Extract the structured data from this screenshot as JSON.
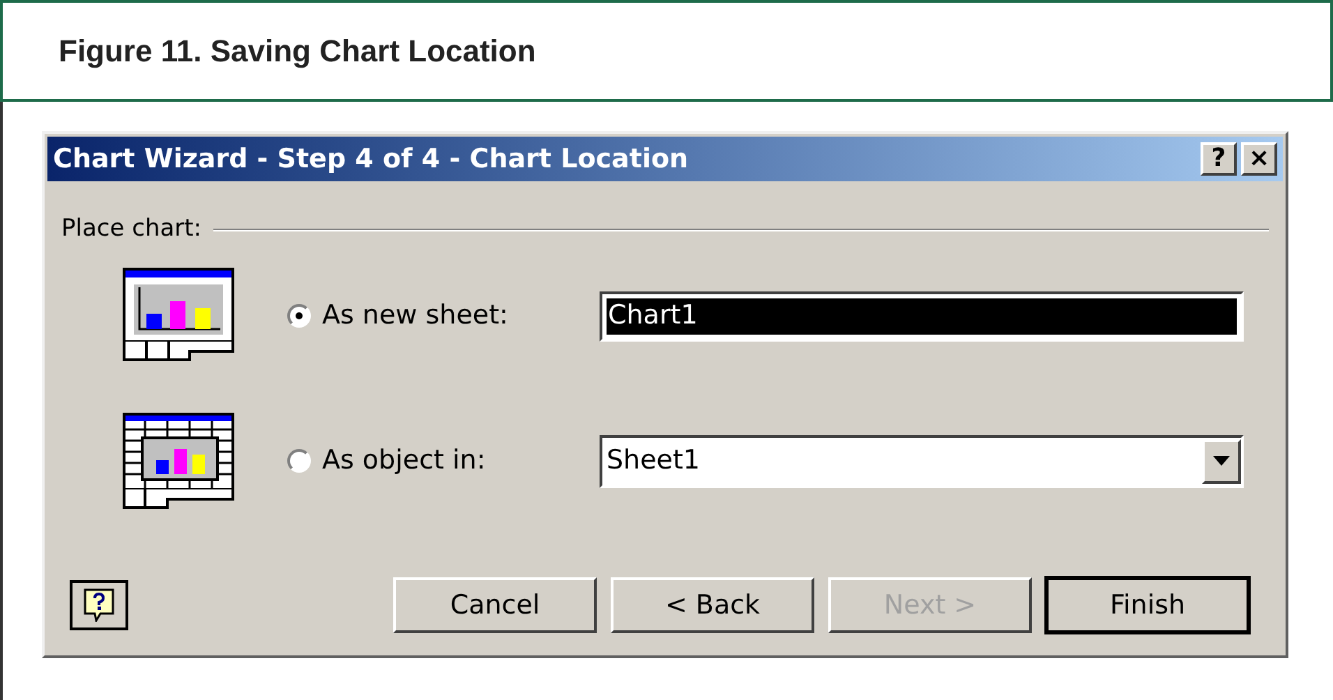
{
  "figure": {
    "caption": "Figure 11. Saving Chart Location"
  },
  "dialog": {
    "title": "Chart Wizard - Step 4 of 4 - Chart Location",
    "title_buttons": [
      {
        "label": "?"
      },
      {
        "label": "×"
      }
    ],
    "group_label": "Place chart:",
    "options": [
      {
        "kind": "sheet",
        "label": "As new sheet:",
        "selected": true,
        "field": {
          "kind": "text",
          "value": "Chart1",
          "highlighted": true
        }
      },
      {
        "kind": "object",
        "label": "As object in:",
        "selected": false,
        "field": {
          "kind": "dropdown",
          "value": "Sheet1",
          "highlighted": false
        }
      }
    ],
    "buttons": [
      {
        "label": "Cancel",
        "disabled": false,
        "default": false
      },
      {
        "label": "< Back",
        "disabled": false,
        "default": false
      },
      {
        "label": "Next >",
        "disabled": true,
        "default": false
      },
      {
        "label": "Finish",
        "disabled": false,
        "default": true
      }
    ]
  }
}
